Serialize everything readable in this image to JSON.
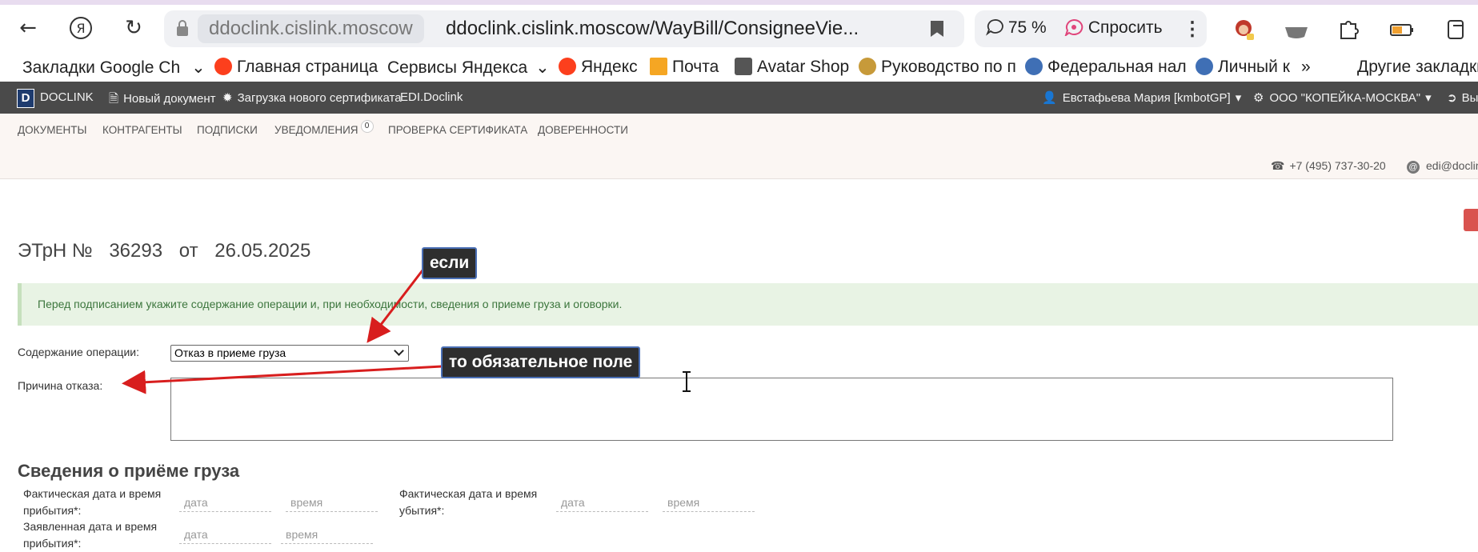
{
  "browser": {
    "host": "ddoclink.cislink.moscow",
    "url": "ddoclink.cislink.moscow/WayBill/ConsigneeVie...",
    "zoom": "75 %",
    "ask_label": "Спросить"
  },
  "bookmarks": [
    {
      "label": "Закладки Google Ch"
    },
    {
      "label": "Главная страница"
    },
    {
      "label": "Сервисы Яндекса"
    },
    {
      "label": "Яндекс"
    },
    {
      "label": "Почта"
    },
    {
      "label": "Avatar Shop"
    },
    {
      "label": "Руководство по п"
    },
    {
      "label": "Федеральная нал"
    },
    {
      "label": "Личный к"
    },
    {
      "label": "Другие закладки"
    }
  ],
  "app_header": {
    "logo_letter": "D",
    "brand": "DOCLINK",
    "new_doc": "Новый документ",
    "upload_cert": "Загрузка нового сертификата",
    "edi": "EDI.Doclink",
    "user": "Евстафьева Мария [kmbotGP]",
    "org": "ООО \"КОПЕЙКА-МОСКВА\"",
    "exit": "Вы"
  },
  "subnav": {
    "items": [
      "ДОКУМЕНТЫ",
      "КОНТРАГЕНТЫ",
      "ПОДПИСКИ",
      "УВЕДОМЛЕНИЯ",
      "ПРОВЕРКА СЕРТИФИКАТА",
      "ДОВЕРЕННОСТИ"
    ],
    "notifications_count": "0",
    "phone": "+7 (495) 737-30-20",
    "email": "edi@doclin"
  },
  "document": {
    "prefix": "ЭТрН №",
    "number": "36293",
    "from": "от",
    "date": "26.05.2025"
  },
  "alert_text": "Перед подписанием укажите содержание операции и, при необходимости, сведения о приеме груза и оговорки.",
  "form": {
    "operation_label": "Содержание операции:",
    "operation_value": "Отказ в приеме груза",
    "reason_label": "Причина отказа:"
  },
  "cargo": {
    "heading": "Сведения о приёме груза",
    "arrival_label_1": "Фактическая дата и время",
    "arrival_label_2": "прибытия*:",
    "departure_label_1": "Фактическая дата и время",
    "departure_label_2": "убытия*:",
    "declared_label_1": "Заявленная дата и время",
    "declared_label_2": "прибытия*:",
    "date_placeholder": "дата",
    "time_placeholder": "время"
  },
  "annotations": {
    "if_label": "если",
    "then_label": "то обязательное поле"
  }
}
